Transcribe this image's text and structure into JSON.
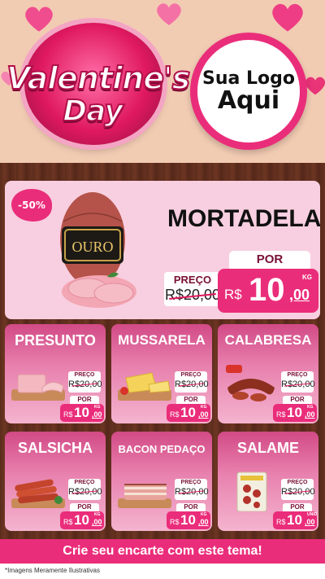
{
  "header": {
    "badge_line1": "Valentine's",
    "badge_line2": "Day",
    "logo_line1": "Sua Logo",
    "logo_line2": "Aqui"
  },
  "featured": {
    "discount": "-50%",
    "product_logo": "OURO",
    "name": "MORTADELA",
    "preco_label": "PREÇO",
    "old_price": "R$20,00",
    "por_label": "POR",
    "currency": "R$",
    "price_int": "10",
    "price_dec": ",00",
    "unit": "KG"
  },
  "cards": [
    {
      "name": "PRESUNTO",
      "preco_label": "PREÇO",
      "old_price": "R$20,00",
      "por_label": "POR",
      "currency": "R$",
      "price_int": "10",
      "price_dec": ",00",
      "unit": "KG"
    },
    {
      "name": "MUSSARELA",
      "preco_label": "PREÇO",
      "old_price": "R$20,00",
      "por_label": "POR",
      "currency": "R$",
      "price_int": "10",
      "price_dec": ",00",
      "unit": "KG"
    },
    {
      "name": "CALABRESA",
      "preco_label": "PREÇO",
      "old_price": "R$20,00",
      "por_label": "POR",
      "currency": "R$",
      "price_int": "10",
      "price_dec": ",00",
      "unit": "KG"
    },
    {
      "name": "SALSICHA",
      "preco_label": "PREÇO",
      "old_price": "R$20,00",
      "por_label": "POR",
      "currency": "R$",
      "price_int": "10",
      "price_dec": ",00",
      "unit": "KG"
    },
    {
      "name": "BACON PEDAÇO",
      "preco_label": "PREÇO",
      "old_price": "R$20,00",
      "por_label": "POR",
      "currency": "R$",
      "price_int": "10",
      "price_dec": ",00",
      "unit": "KG"
    },
    {
      "name": "SALAME",
      "preco_label": "PREÇO",
      "old_price": "R$20,00",
      "por_label": "POR",
      "currency": "R$",
      "price_int": "10",
      "price_dec": ",00",
      "unit": "UNID"
    }
  ],
  "cta": "Crie seu encarte com este tema!",
  "footer_note": "*Imagens Meramente Ilustrativas",
  "colors": {
    "accent": "#ea2d7a",
    "card_top": "#d24a86",
    "featured_bg": "#f8cfe0",
    "wood": "#5b2c1c",
    "header_bg": "#f2cbb3"
  }
}
